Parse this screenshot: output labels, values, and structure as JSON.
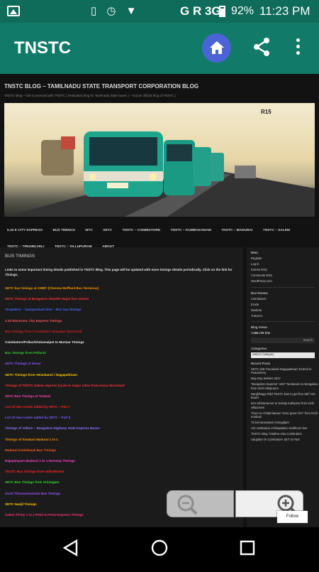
{
  "status_bar": {
    "network": "G R 3G",
    "battery_pct": "92%",
    "time": "11:23 PM",
    "battery_level": 0.92,
    "icons": [
      "gallery-icon",
      "vibrate-icon",
      "alarm-icon",
      "wifi-icon",
      "signal-icon",
      "battery-icon"
    ]
  },
  "app_bar": {
    "title": "TNSTC",
    "accent": "#117a68",
    "home_color": "#4a64d6"
  },
  "page": {
    "blog_title": "TNSTC BLOG – TAMILNADU STATE TRANSPORT CORPORATION BLOG",
    "tagline": "TNSTC Blog ~ Get Connected with TNSTC ( Dedicated blog for Tamilnadu State buses ) ~ Not an official blog of TNSTC )",
    "bus_plate": "R15",
    "nav": [
      "5.33 E CITY EXPRESS",
      "BUS TIMINGS",
      "MTC",
      "SETC",
      "TNSTC – COIMBATORE",
      "TNSTC – KUMBAKONAM",
      "TNSTC – MADURAI",
      "TNSTC – SALEM",
      "TNSTC – TIRUNELVELI",
      "TNSTC – VILLUPURAM",
      "ABOUT"
    ],
    "main": {
      "heading": "BUS TIMINGS",
      "intro": "Links to some important timing details published in TNSTC Blog. This page will be updated with more timings details periodically. Click on the link for Timings.",
      "links": [
        {
          "text": "SETC bus timings at CMBT (Chennai Moffusil Bus Terminus)",
          "color": "#ff9900"
        },
        {
          "text": "SETC Timings at Bangalore Shanthi Nagar bus station",
          "color": "#ff3333"
        },
        {
          "text": "Tirupathur – Vaniyambadi time – Bus bus timings",
          "color": "#4466ff"
        },
        {
          "text": "3.33 Electronic City Express Timings",
          "color": "#ff5555"
        },
        {
          "text": "Bus timings from Coimbatore Ukkadam Busstand",
          "color": "#cc2222"
        },
        {
          "text": "Coimbatore/Pollachi/Udumalpet to Munnar Timings",
          "color": "#e8e8e8"
        },
        {
          "text": "Bus Timings from Pollachi",
          "color": "#33cc33"
        },
        {
          "text": "SETC Timings at Hosur",
          "color": "#8855ff"
        },
        {
          "text": "SETC Timings from Velankanni / Nagapattinam",
          "color": "#ffcc00"
        },
        {
          "text": "Timings of TNSTC-Salem express buses to major cities from Hosur Busstand",
          "color": "#ff3333"
        },
        {
          "text": "SETC Bus Timings at Tenkasi",
          "color": "#ff44aa"
        },
        {
          "text": "List of new routes added by SETC – Part I",
          "color": "#ff2222"
        },
        {
          "text": "List of new routes added by SETC – Part II",
          "color": "#7a5cff"
        },
        {
          "text": "Timings of Vellore – Bangalore Highway State Express Buses",
          "color": "#8877ff"
        },
        {
          "text": "Timings of Sivakasi Madurai 1 to 1",
          "color": "#ff9900"
        },
        {
          "text": "Madurai Kodaikanal Bus Timings",
          "color": "#ff5522"
        },
        {
          "text": "Rajapalayam Madurai 1 to 1 Nonstop Timings",
          "color": "#ff44cc"
        },
        {
          "text": "TNSTC Bus Timings from Udhukkottai",
          "color": "#ff2222"
        },
        {
          "text": "SETC Bus Timings from Srirangam",
          "color": "#33dd33"
        },
        {
          "text": "Surat Thiruvannamalai Bus Timings",
          "color": "#9955ff"
        },
        {
          "text": "SETC Nanjil Timings",
          "color": "#ffcc00"
        },
        {
          "text": "Salem Trichy 1 to 1 Point to Point Express Timings",
          "color": "#ff3377"
        }
      ]
    },
    "sidebar": {
      "meta_head": "Meta",
      "meta_items": [
        "Register",
        "Log in",
        "Entries RSS",
        "Comments RSS",
        "WordPress.com"
      ],
      "routes_head": "Bus Routes",
      "routes_items": [
        "Coimbatore",
        "Erode",
        "Madurai",
        "Tuticorin"
      ],
      "views_head": "Blog Views",
      "views_value": "7,056,745 hits",
      "search_button": "Search",
      "categories_head": "Categories",
      "select_category": "Select Category",
      "recent_head": "Recent Posts",
      "recent_items": [
        "SETC 529 Tirunelveli Nagapattinam Extend to Puducherry",
        "May Day Wishes 2017",
        "\"Bangalore Express\" 4447 Tambaram to Bengaluru from trichi-villupuram",
        "Nanjil/Naga Rikil TNSTC Bus to get free WiFi On-board",
        "504 Uthirameroor to Solody kathipara from trichi villupuram",
        "Thoni to Chidambaram \"Ever green fort\" from trichi madurai",
        "78 kumaravasam chengalpet",
        "121 tambaram uchinapalam vedithrum bus",
        "TNSTC Blog 7Stakha Visa Celebration",
        "Udupilam fe Coimbatore SET III Park"
      ]
    }
  },
  "overlay": {
    "follow_label": "Follow"
  }
}
